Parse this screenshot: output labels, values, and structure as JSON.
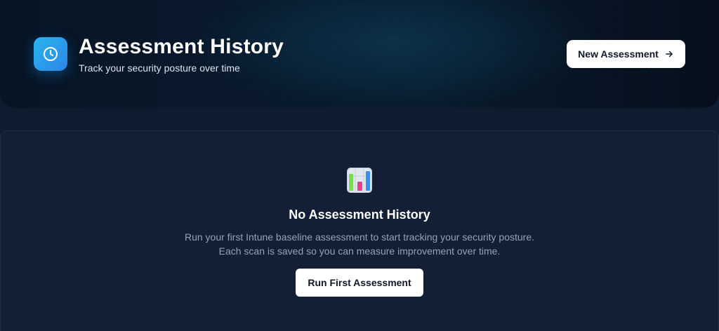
{
  "header": {
    "title": "Assessment History",
    "subtitle": "Track your security posture over time",
    "icon": "clock-icon",
    "new_button_label": "New Assessment",
    "new_button_icon": "arrow-right-icon"
  },
  "empty_state": {
    "icon": "bar-chart-icon",
    "title": "No Assessment History",
    "description": "Run your first Intune baseline assessment to start tracking your security posture. Each scan is saved so you can measure improvement over time.",
    "button_label": "Run First Assessment"
  },
  "colors": {
    "accent": "#2c9be8",
    "background": "#0f1c2f",
    "panel": "#121f35"
  }
}
